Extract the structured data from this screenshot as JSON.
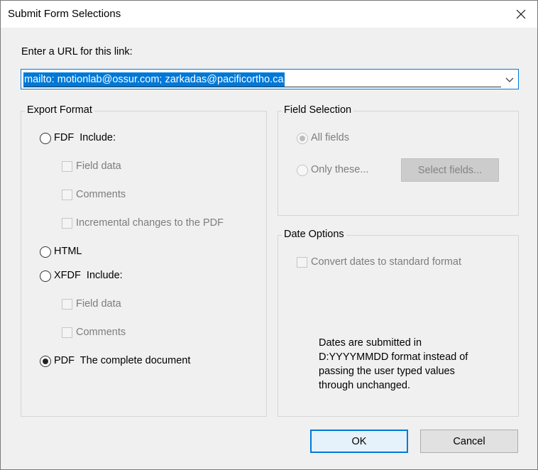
{
  "window": {
    "title": "Submit Form Selections",
    "close_icon": "close-icon"
  },
  "url": {
    "label": "Enter a URL for this link:",
    "value": "mailto: motionlab@ossur.com; zarkadas@pacificortho.ca"
  },
  "export_format": {
    "legend": "Export Format",
    "fdf": {
      "label": "FDF  Include:",
      "selected": false
    },
    "fdf_options": [
      {
        "label": "Field data",
        "checked": false,
        "enabled": false
      },
      {
        "label": "Comments",
        "checked": false,
        "enabled": false
      },
      {
        "label": "Incremental changes to the PDF",
        "checked": false,
        "enabled": false
      }
    ],
    "html": {
      "label": "HTML",
      "selected": false
    },
    "xfdf": {
      "label": "XFDF  Include:",
      "selected": false
    },
    "xfdf_options": [
      {
        "label": "Field data",
        "checked": false,
        "enabled": false
      },
      {
        "label": "Comments",
        "checked": false,
        "enabled": false
      }
    ],
    "pdf": {
      "label": "PDF  The complete document",
      "selected": true
    }
  },
  "field_selection": {
    "legend": "Field Selection",
    "all_fields": {
      "label": "All fields",
      "selected": true,
      "enabled": false
    },
    "only_these": {
      "label": "Only these...",
      "selected": false,
      "enabled": false
    },
    "select_fields_button": "Select fields..."
  },
  "date_options": {
    "legend": "Date Options",
    "convert": {
      "label": "Convert dates to standard format",
      "checked": false,
      "enabled": false
    },
    "note_lines": [
      "Dates are submitted in",
      "D:YYYYMMDD format instead of",
      "passing the user typed values",
      "through unchanged."
    ]
  },
  "buttons": {
    "ok": "OK",
    "cancel": "Cancel"
  },
  "colors": {
    "accent": "#0078d7",
    "background": "#f0f0f0"
  }
}
